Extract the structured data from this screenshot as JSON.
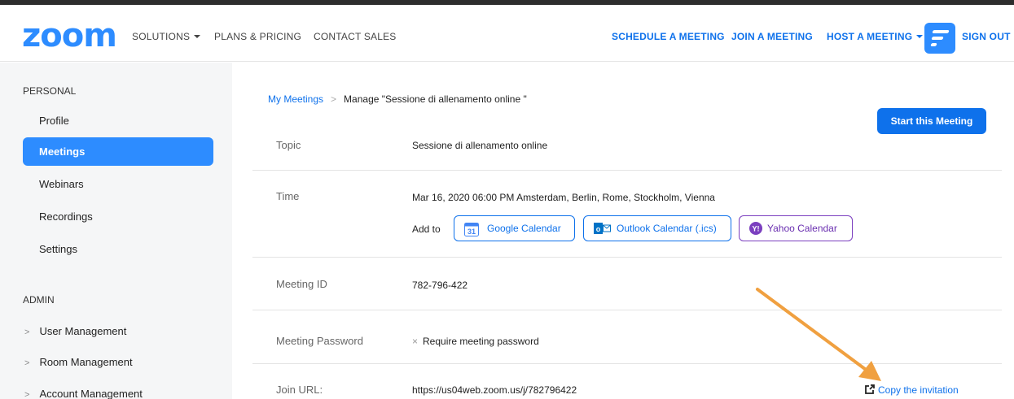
{
  "header": {
    "logo": "zoom",
    "nav_left": [
      "SOLUTIONS",
      "PLANS & PRICING",
      "CONTACT SALES"
    ],
    "nav_right": [
      "SCHEDULE A MEETING",
      "JOIN A MEETING",
      "HOST A MEETING",
      "SIGN OUT"
    ]
  },
  "sidebar": {
    "personal_label": "PERSONAL",
    "items": [
      "Profile",
      "Meetings",
      "Webinars",
      "Recordings",
      "Settings"
    ],
    "active": "Meetings",
    "admin_label": "ADMIN",
    "admin_items": [
      "User Management",
      "Room Management",
      "Account Management"
    ]
  },
  "breadcrumb": {
    "link": "My Meetings",
    "separator": ">",
    "current": "Manage \"Sessione di allenamento online \""
  },
  "start_button": "Start this Meeting",
  "meeting": {
    "topic_label": "Topic",
    "topic": "Sessione di allenamento online",
    "time_label": "Time",
    "time": "Mar 16, 2020 06:00 PM Amsterdam, Berlin, Rome, Stockholm, Vienna",
    "add_to": "Add to",
    "calendars": [
      "Google Calendar",
      "Outlook Calendar (.ics)",
      "Yahoo Calendar"
    ],
    "id_label": "Meeting ID",
    "id": "782-796-422",
    "password_label": "Meeting Password",
    "password_value": "Require meeting password",
    "join_label": "Join URL:",
    "join_url": "https://us04web.zoom.us/j/782796422",
    "copy_invitation": "Copy the invitation"
  },
  "icons": {
    "google_calendar_day": "31",
    "outlook": "outlook-icon",
    "yahoo": "yahoo-icon"
  },
  "colors": {
    "brand": "#2d8cff",
    "link": "#0e71eb",
    "arrow": "#f0a040",
    "yahoo": "#7b3fbf"
  }
}
